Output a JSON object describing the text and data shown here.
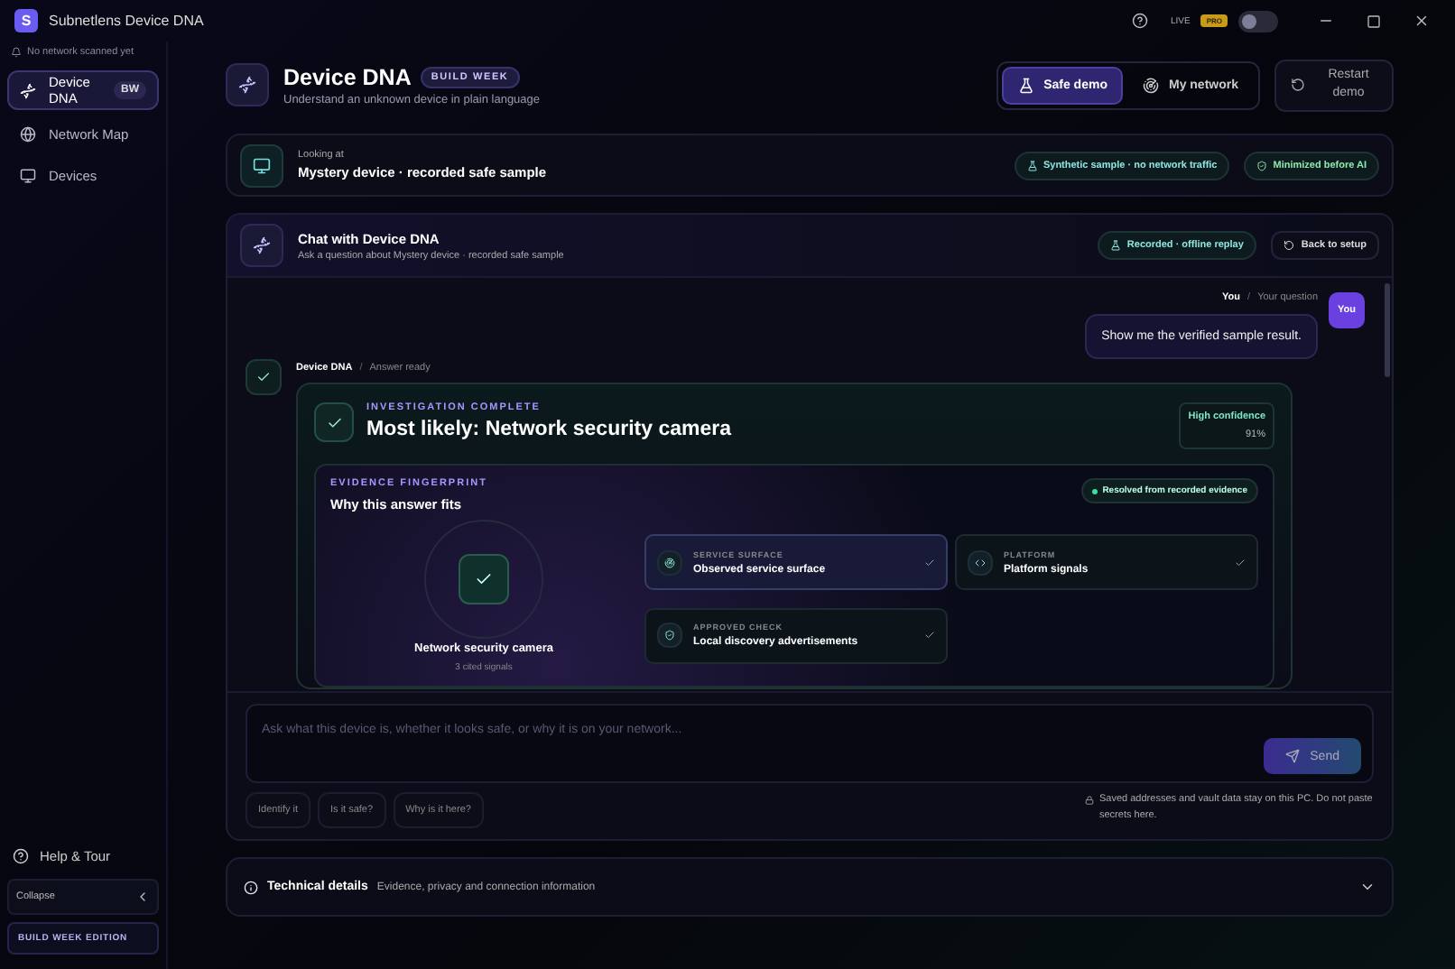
{
  "app": {
    "title": "Subnetlens Device DNA",
    "logo_letter": "S"
  },
  "title_bar": {
    "live_label": "LIVE",
    "pro_badge": "PRO",
    "live_on": false
  },
  "sidebar": {
    "status": "No network scanned yet",
    "items": [
      {
        "label": "Device DNA",
        "badge": "BW",
        "selected": true
      },
      {
        "label": "Network Map",
        "selected": false
      },
      {
        "label": "Devices",
        "selected": false
      }
    ],
    "help": "Help & Tour",
    "collapse": "Collapse",
    "edition": "BUILD WEEK EDITION"
  },
  "header": {
    "title": "Device DNA",
    "badge": "BUILD WEEK",
    "subtitle": "Understand an unknown device in plain language",
    "modes": [
      {
        "label": "Safe demo",
        "selected": true
      },
      {
        "label": "My network",
        "selected": false
      }
    ],
    "restart": "Restart demo"
  },
  "looking": {
    "label": "Looking at",
    "value": "Mystery device · recorded safe sample",
    "chips": [
      {
        "label": "Synthetic sample · no network traffic",
        "kind": "sample"
      },
      {
        "label": "Minimized before AI",
        "kind": "privacy"
      }
    ]
  },
  "chat": {
    "title": "Chat with Device DNA",
    "subtitle": "Ask a question about Mystery device · recorded safe sample",
    "status": "Recorded · offline replay",
    "back": "Back to setup",
    "user": {
      "author": "You",
      "separator": "/",
      "meta": "Your question",
      "avatar": "You",
      "text": "Show me the verified sample result."
    },
    "answer": {
      "author": "Device DNA",
      "separator": "/",
      "meta": "Answer ready",
      "eyebrow": "INVESTIGATION COMPLETE",
      "title": "Most likely: Network security camera",
      "confidence_label": "High confidence",
      "confidence_value": "91%",
      "evidence": {
        "eyebrow": "EVIDENCE FINGERPRINT",
        "title": "Why this answer fits",
        "resolved": "Resolved from recorded evidence",
        "center_title": "Network security camera",
        "center_sub": "3 cited signals",
        "signals": [
          {
            "category": "SERVICE SURFACE",
            "label": "Observed service surface",
            "selected": true
          },
          {
            "category": "PLATFORM",
            "label": "Platform signals",
            "selected": false
          },
          {
            "category": "APPROVED CHECK",
            "label": "Local discovery advertisements",
            "selected": false
          }
        ]
      }
    }
  },
  "composer": {
    "placeholder": "Ask what this device is, whether it looks safe, or why it is on your network...",
    "send": "Send",
    "suggestions": [
      "Identify it",
      "Is it safe?",
      "Why is it here?"
    ],
    "note": "Saved addresses and vault data stay on this PC. Do not paste secrets here."
  },
  "technical": {
    "title": "Technical details",
    "subtitle": "Evidence, privacy and connection information",
    "expanded": false
  }
}
